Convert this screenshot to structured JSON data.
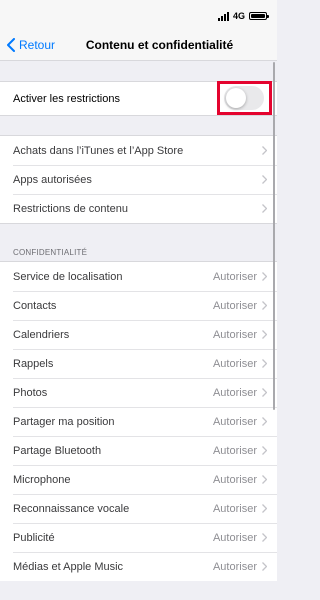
{
  "status_bar": {
    "network": "4G"
  },
  "nav": {
    "back_label": "Retour",
    "title": "Contenu et confidentialité"
  },
  "restrictions": {
    "label": "Activer les restrictions",
    "enabled": false
  },
  "menu": {
    "items": [
      {
        "label": "Achats dans l’iTunes et l’App Store"
      },
      {
        "label": "Apps autorisées"
      },
      {
        "label": "Restrictions de contenu"
      }
    ]
  },
  "privacy": {
    "header": "CONFIDENTIALITÉ",
    "items": [
      {
        "label": "Service de localisation",
        "value": "Autoriser"
      },
      {
        "label": "Contacts",
        "value": "Autoriser"
      },
      {
        "label": "Calendriers",
        "value": "Autoriser"
      },
      {
        "label": "Rappels",
        "value": "Autoriser"
      },
      {
        "label": "Photos",
        "value": "Autoriser"
      },
      {
        "label": "Partager ma position",
        "value": "Autoriser"
      },
      {
        "label": "Partage Bluetooth",
        "value": "Autoriser"
      },
      {
        "label": "Microphone",
        "value": "Autoriser"
      },
      {
        "label": "Reconnaissance vocale",
        "value": "Autoriser"
      },
      {
        "label": "Publicité",
        "value": "Autoriser"
      },
      {
        "label": "Médias et Apple Music",
        "value": "Autoriser"
      }
    ]
  },
  "colors": {
    "accent": "#007aff",
    "highlight": "#e4032e",
    "background": "#efeff4"
  }
}
